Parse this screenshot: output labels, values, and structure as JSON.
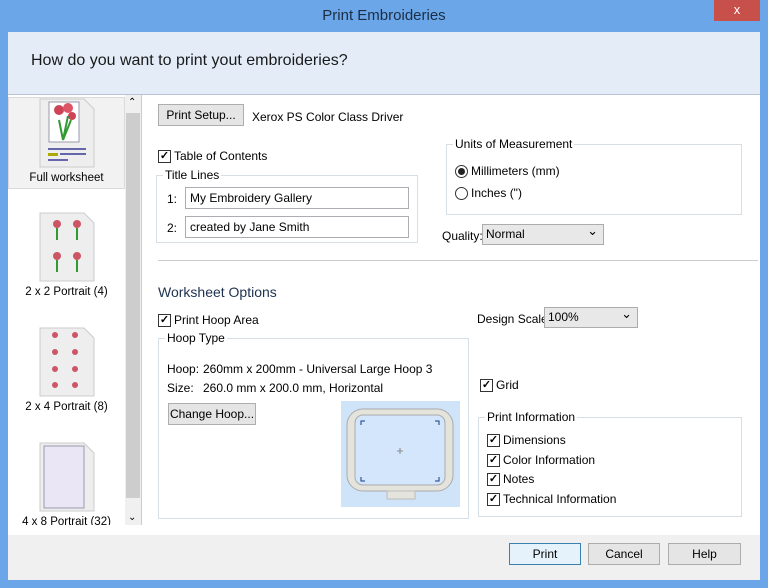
{
  "window": {
    "title": "Print Embroideries",
    "close_label": "x"
  },
  "header": {
    "question": "How do you want to print yout embroideries?"
  },
  "layouts": [
    {
      "label": "Full worksheet",
      "selected": true
    },
    {
      "label": "2 x 2 Portrait (4)"
    },
    {
      "label": "2 x 4 Portrait (8)"
    },
    {
      "label": "4 x 8 Portrait (32)"
    }
  ],
  "printer": {
    "setup_label": "Print Setup...",
    "driver": "Xerox PS Color Class Driver"
  },
  "toc": {
    "label": "Table of Contents",
    "checked": true
  },
  "title_lines": {
    "label": "Title Lines",
    "line1_num": "1:",
    "line1": "My Embroidery Gallery",
    "line2_num": "2:",
    "line2": "created by Jane Smith"
  },
  "units": {
    "label": "Units of Measurement",
    "options": [
      "Millimeters (mm)",
      "Inches (\")"
    ],
    "selected": "Millimeters (mm)"
  },
  "quality": {
    "label": "Quality:",
    "value": "Normal"
  },
  "worksheet": {
    "heading": "Worksheet Options",
    "print_hoop_label": "Print Hoop Area",
    "design_scale_label": "Design Scale:",
    "design_scale_value": "100%",
    "grid_label": "Grid"
  },
  "hoop": {
    "label": "Hoop Type",
    "hoop_label": "Hoop:",
    "hoop_value": "260mm x 200mm - Universal Large Hoop 3",
    "size_label": "Size:",
    "size_value": "260.0 mm x 200.0 mm, Horizontal",
    "change_label": "Change Hoop..."
  },
  "print_info": {
    "label": "Print Information",
    "items": [
      "Dimensions",
      "Color Information",
      "Notes",
      "Technical Information"
    ]
  },
  "footer": {
    "print": "Print",
    "cancel": "Cancel",
    "help": "Help"
  },
  "colors": {
    "titlebar": "#6aa6e8",
    "header": "#e3ecf7",
    "close": "#c7504a",
    "hoop_bg": "#cfe3f9"
  }
}
